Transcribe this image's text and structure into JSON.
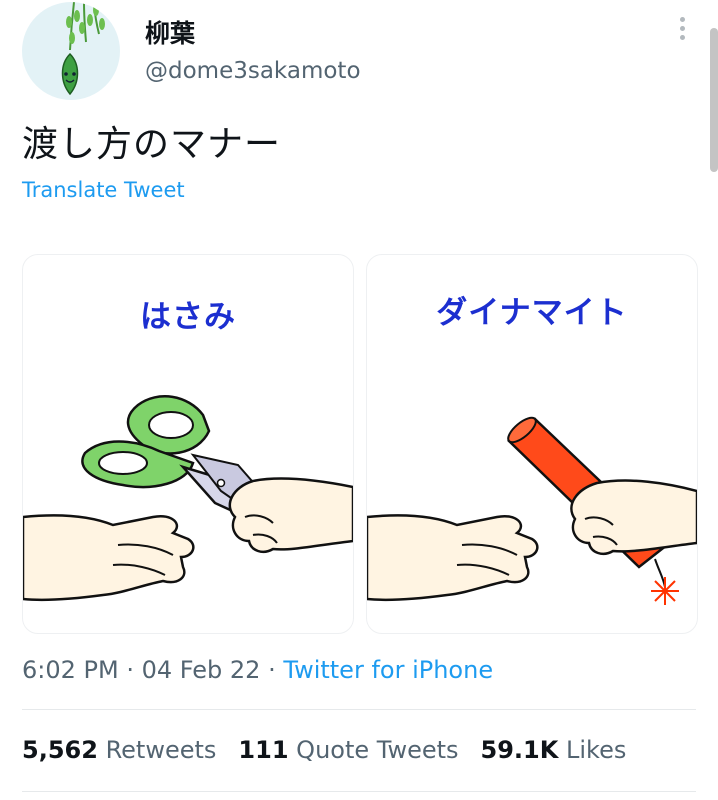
{
  "author": {
    "display_name": "柳葉",
    "handle": "@dome3sakamoto"
  },
  "tweet": {
    "text": "渡し方のマナー",
    "translate_label": "Translate Tweet"
  },
  "media": [
    {
      "title": "はさみ",
      "icon": "scissors-handover-illustration"
    },
    {
      "title": "ダイナマイト",
      "icon": "dynamite-handover-illustration"
    }
  ],
  "meta": {
    "time": "6:02 PM",
    "separator": "·",
    "date": "04 Feb 22",
    "source": "Twitter for iPhone"
  },
  "stats": {
    "retweets_count": "5,562",
    "retweets_label": "Retweets",
    "quotes_count": "111",
    "quotes_label": "Quote Tweets",
    "likes_count": "59.1K",
    "likes_label": "Likes"
  },
  "colors": {
    "link": "#1d9bf0",
    "secondary_text": "#536471",
    "card_title": "#1c2fd0",
    "scissors_handle": "#7fd36a",
    "dynamite": "#ff4a1a"
  }
}
